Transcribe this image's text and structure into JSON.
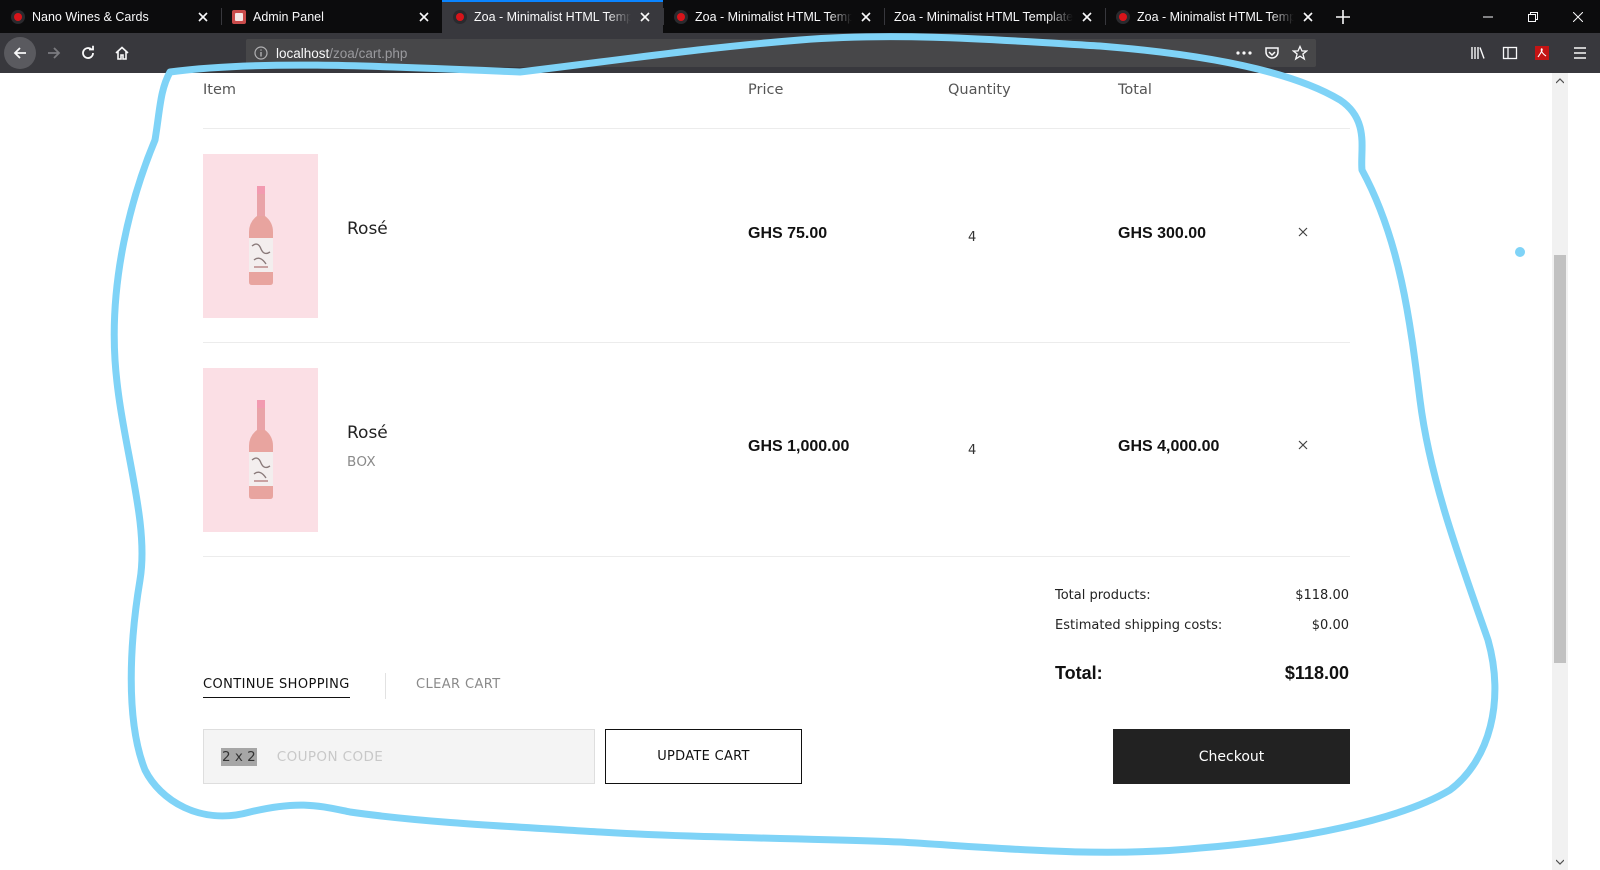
{
  "browser": {
    "tabs": [
      {
        "title": "Nano Wines & Cards",
        "favicon": "zoa-favicon",
        "active": false
      },
      {
        "title": "Admin Panel",
        "favicon": "admin-favicon",
        "active": false
      },
      {
        "title": "Zoa - Minimalist HTML Template",
        "favicon": "zoa-favicon",
        "active": true
      },
      {
        "title": "Zoa - Minimalist HTML Template",
        "favicon": "zoa-favicon",
        "active": false
      },
      {
        "title": "Zoa - Minimalist HTML Template P",
        "favicon": "none",
        "active": false
      },
      {
        "title": "Zoa - Minimalist HTML Template",
        "favicon": "zoa-favicon",
        "active": false
      }
    ],
    "url_host": "localhost",
    "url_path": "/zoa/cart.php",
    "accent_color": "#0a84ff"
  },
  "cart": {
    "headers": {
      "item": "Item",
      "price": "Price",
      "quantity": "Quantity",
      "total": "Total"
    },
    "items": [
      {
        "name": "Rosé",
        "variant": "",
        "price": "GHS 75.00",
        "quantity": "4",
        "total": "GHS 300.00"
      },
      {
        "name": "Rosé",
        "variant": "BOX",
        "price": "GHS 1,000.00",
        "quantity": "4",
        "total": "GHS 4,000.00"
      }
    ],
    "summary": {
      "products_label": "Total products:",
      "products_value": "$118.00",
      "shipping_label": "Estimated shipping costs:",
      "shipping_value": "$0.00",
      "total_label": "Total:",
      "total_value": "$118.00"
    },
    "continue_label": "CONTINUE SHOPPING",
    "clear_label": "CLEAR CART",
    "coupon": {
      "value": "2 x 2",
      "placeholder": "COUPON CODE"
    },
    "update_label": "UPDATE CART",
    "checkout_label": "Checkout",
    "thumb_bg": "#fbdfe5"
  },
  "annotation": {
    "color": "#7fd3f7"
  }
}
